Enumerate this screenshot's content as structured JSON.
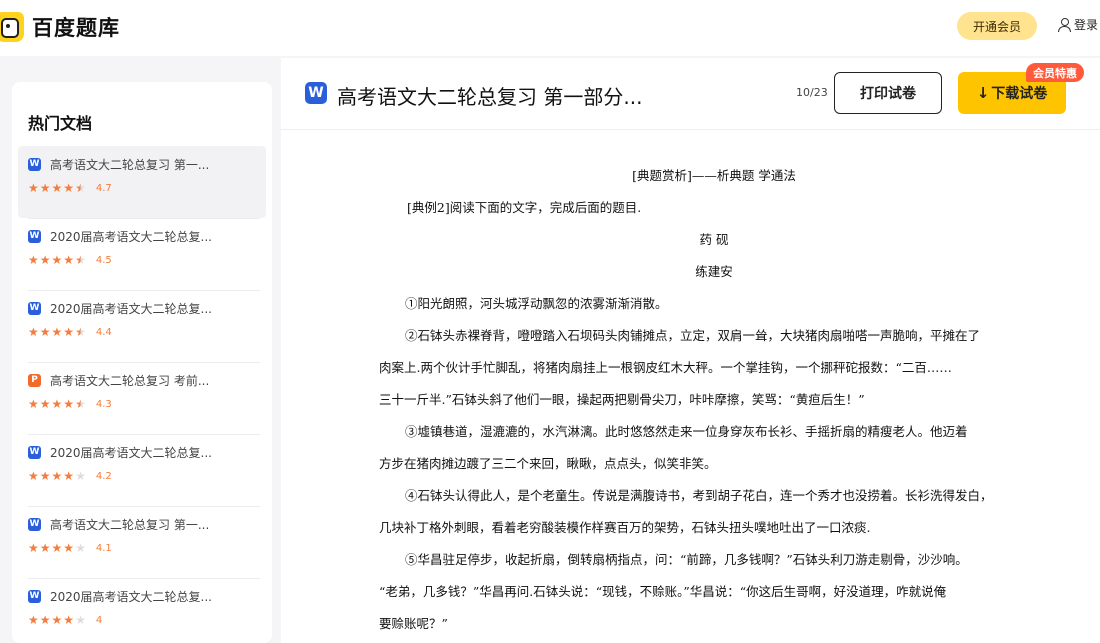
{
  "header": {
    "logo_text": "百度题库",
    "vip_label": "开通会员",
    "login_label": "登录"
  },
  "sidebar": {
    "title": "热门文档",
    "items": [
      {
        "type": "W",
        "name": "高考语文大二轮总复习 第一...",
        "rating": 4.7,
        "score": "4.7"
      },
      {
        "type": "W",
        "name": "2020届高考语文大二轮总复...",
        "rating": 4.5,
        "score": "4.5"
      },
      {
        "type": "W",
        "name": "2020届高考语文大二轮总复...",
        "rating": 4.4,
        "score": "4.4"
      },
      {
        "type": "P",
        "name": "高考语文大二轮总复习 考前...",
        "rating": 4.3,
        "score": "4.3"
      },
      {
        "type": "W",
        "name": "2020届高考语文大二轮总复...",
        "rating": 4.2,
        "score": "4.2"
      },
      {
        "type": "W",
        "name": "高考语文大二轮总复习 第一...",
        "rating": 4.1,
        "score": "4.1"
      },
      {
        "type": "W",
        "name": "2020届高考语文大二轮总复...",
        "rating": 4.0,
        "score": "4"
      }
    ]
  },
  "document": {
    "icon_letter": "W",
    "title": "高考语文大二轮总复习 第一部分...",
    "page_counter": "10/23",
    "print_label": "打印试卷",
    "download_label": "下载试卷",
    "promo_tag": "会员特惠",
    "lines": [
      {
        "text": "[典题赏析]——析典题  学通法",
        "style": "center"
      },
      {
        "text": "[典例2]阅读下面的文字，完成后面的题目.",
        "style": "indent-small"
      },
      {
        "text": "药  砚",
        "style": "center"
      },
      {
        "text": "练建安",
        "style": "center"
      },
      {
        "text": "①阳光朗照，河头城浮动飘忽的浓雾渐渐消散。",
        "style": "indent"
      },
      {
        "text": "②石钵头赤裸脊背，噔噔踏入石坝码头肉铺摊点，立定，双肩一耸，大块猪肉扇啪嗒一声脆响，平摊在了",
        "style": "indent"
      },
      {
        "text": "肉案上.两个伙计手忙脚乱，将猪肉扇挂上一根钢皮红木大秤。一个掌挂钩，一个挪秤砣报数：“二百……",
        "style": ""
      },
      {
        "text": "三十一斤半.”石钵头斜了他们一眼，操起两把剔骨尖刀，咔咔摩擦，笑骂：“黄疸后生！”",
        "style": ""
      },
      {
        "text": "③墟镇巷道，湿漉漉的，水汽淋漓。此时悠悠然走来一位身穿灰布长衫、手摇折扇的精瘦老人。他迈着",
        "style": "indent"
      },
      {
        "text": "方步在猪肉摊边踱了三二个来回，瞅瞅，点点头，似笑非笑。",
        "style": ""
      },
      {
        "text": "④石钵头认得此人，是个老童生。传说是满腹诗书，考到胡子花白，连一个秀才也没捞着。长衫洗得发白，",
        "style": "indent"
      },
      {
        "text": "几块补丁格外刺眼，看着老穷酸装模作样赛百万的架势，石钵头扭头噗地吐出了一口浓痰.",
        "style": ""
      },
      {
        "text": "⑤华昌驻足停步，收起折扇，倒转扇柄指点，问：“前蹄，几多钱啊？”石钵头利刀游走剔骨，沙沙响。",
        "style": "indent"
      },
      {
        "text": "“老弟，几多钱？”华昌再问.石钵头说：“现钱，不赊账。”华昌说：“你这后生哥啊，好没道理，咋就说俺",
        "style": ""
      },
      {
        "text": "要赊账呢？”",
        "style": ""
      }
    ]
  },
  "colors": {
    "accent_yellow": "#ffc400",
    "word_blue": "#2b5fd9",
    "star_orange": "#f57c3a",
    "promo_red": "#ff5a3c"
  }
}
